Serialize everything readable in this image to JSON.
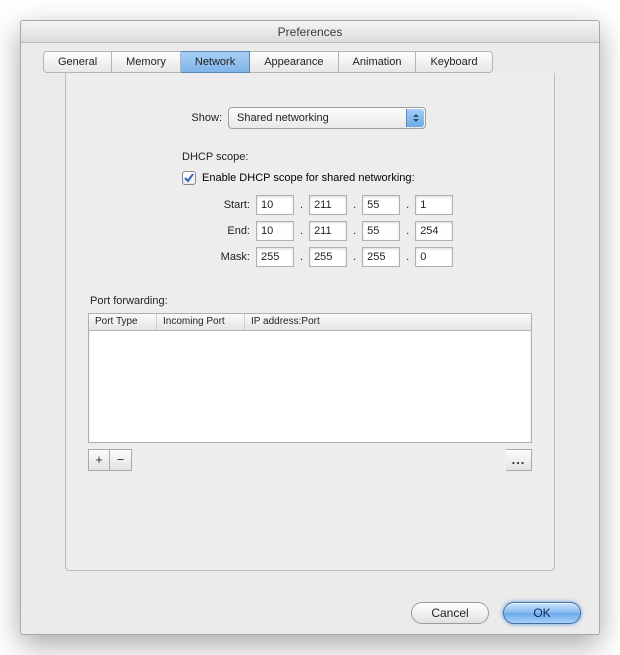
{
  "window": {
    "title": "Preferences"
  },
  "tabs": {
    "general": "General",
    "memory": "Memory",
    "network": "Network",
    "appearance": "Appearance",
    "animation": "Animation",
    "keyboard": "Keyboard"
  },
  "show": {
    "label": "Show:",
    "value": "Shared networking"
  },
  "dhcp": {
    "title": "DHCP scope:",
    "enable_label": "Enable DHCP scope for shared networking:",
    "enabled": true,
    "start_label": "Start:",
    "end_label": "End:",
    "mask_label": "Mask:",
    "start": [
      "10",
      "211",
      "55",
      "1"
    ],
    "end": [
      "10",
      "211",
      "55",
      "254"
    ],
    "mask": [
      "255",
      "255",
      "255",
      "0"
    ]
  },
  "pf": {
    "title": "Port forwarding:",
    "cols": {
      "type": "Port Type",
      "incoming": "Incoming Port",
      "ipport": "IP address:Port"
    },
    "rows": [],
    "add": "+",
    "remove": "−",
    "more": "..."
  },
  "buttons": {
    "cancel": "Cancel",
    "ok": "OK"
  }
}
